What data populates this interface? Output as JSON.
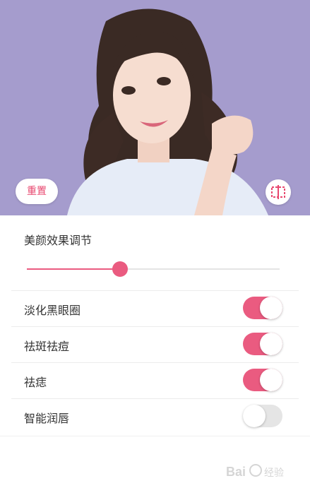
{
  "photo": {
    "reset_label": "重置",
    "compare_icon": "compare-split-icon"
  },
  "beauty": {
    "title": "美颜效果调节",
    "slider_value": 0.37
  },
  "toggles": [
    {
      "label": "淡化黑眼圈",
      "on": true
    },
    {
      "label": "祛斑祛痘",
      "on": true
    },
    {
      "label": "祛痣",
      "on": true
    },
    {
      "label": "智能润唇",
      "on": false
    }
  ],
  "colors": {
    "accent": "#ea5b80",
    "photo_bg": "#a59cce"
  },
  "watermark": "Baidu 经验"
}
